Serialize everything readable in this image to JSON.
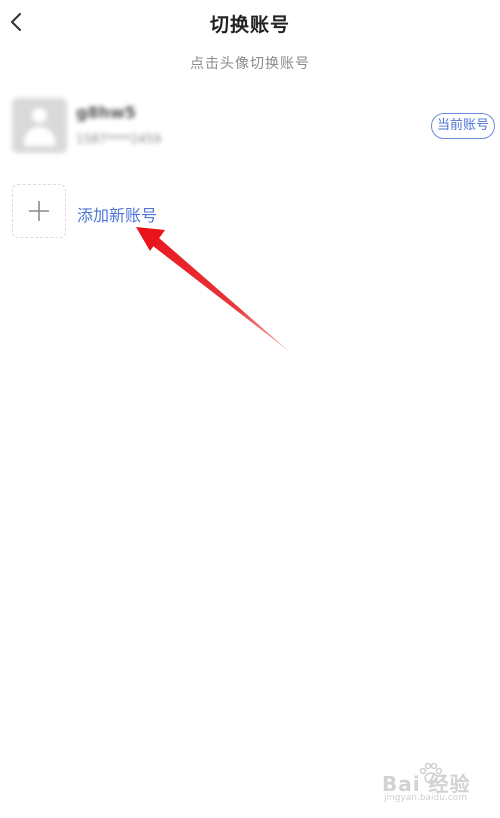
{
  "header": {
    "title": "切换账号",
    "back_icon": "chevron-left-icon"
  },
  "hint": "点击头像切换账号",
  "account": {
    "name": "g8hw5",
    "phone": "1587****2459",
    "badge": "当前账号",
    "avatar_icon": "user-avatar-icon"
  },
  "add_account": {
    "label": "添加新账号",
    "icon": "plus-icon"
  },
  "annotation": {
    "type": "red-arrow",
    "color": "#e8141a"
  },
  "watermark": {
    "brand": "Bai  经验",
    "url": "jingyan.baidu.com"
  },
  "colors": {
    "accent": "#4d74d6",
    "hint": "#8a8a8a",
    "title": "#222222"
  }
}
